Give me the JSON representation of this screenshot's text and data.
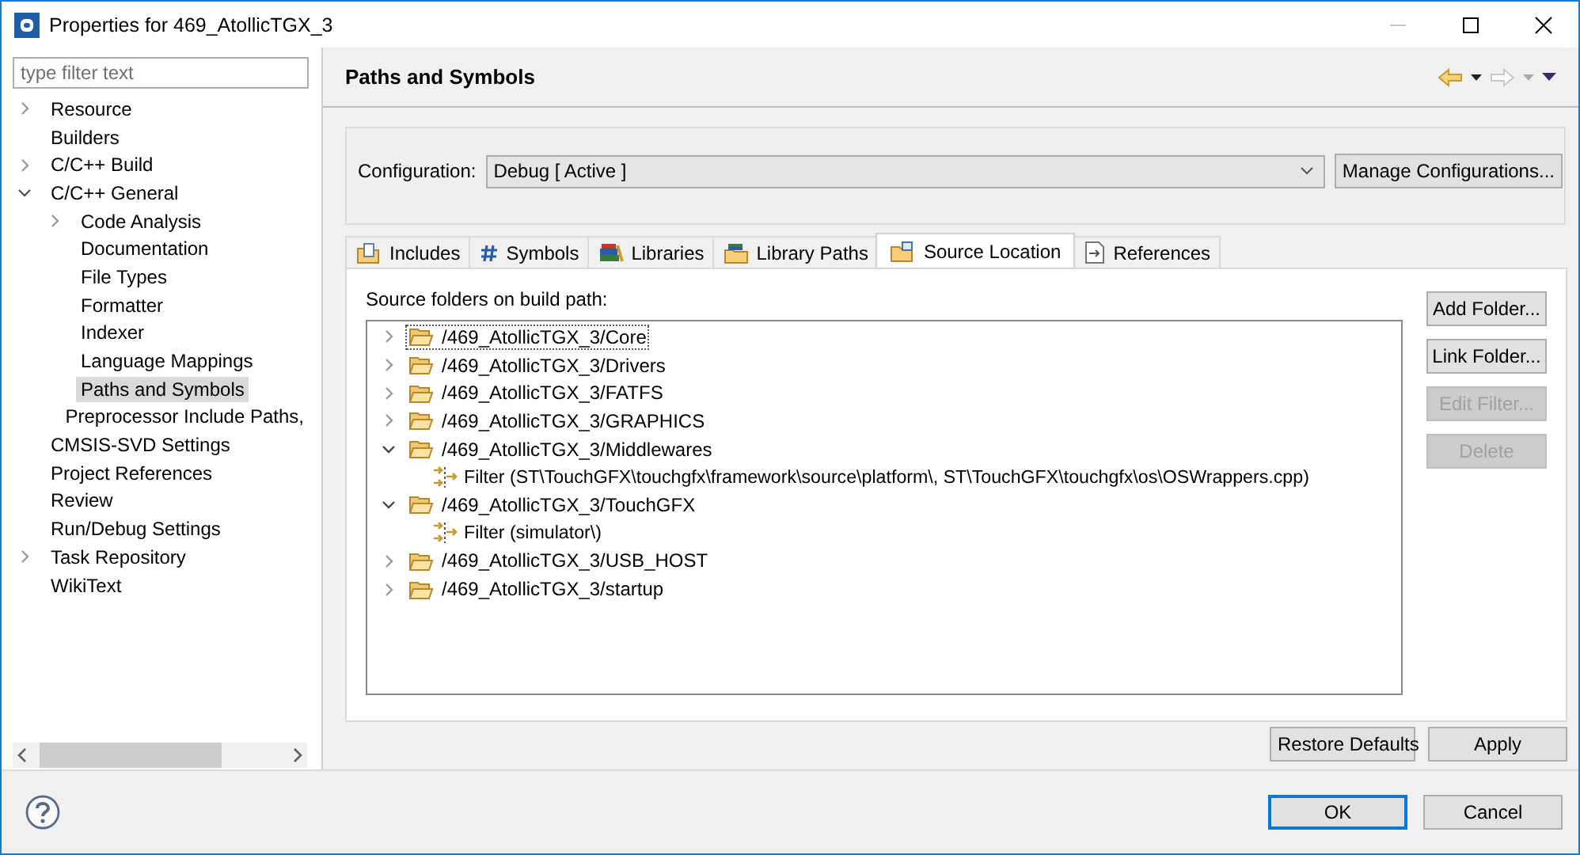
{
  "window": {
    "title": "Properties for 469_AtollicTGX_3"
  },
  "sidebar": {
    "filter": {
      "placeholder": "type filter text"
    },
    "items": [
      {
        "label": "Resource",
        "expanded": false,
        "selected": false
      },
      {
        "label": "Builders",
        "selected": false
      },
      {
        "label": "C/C++ Build",
        "expanded": false,
        "selected": false
      },
      {
        "label": "C/C++ General",
        "expanded": true,
        "selected": false,
        "children": [
          {
            "label": "Code Analysis",
            "expanded": false,
            "selected": false
          },
          {
            "label": "Documentation",
            "selected": false
          },
          {
            "label": "File Types",
            "selected": false
          },
          {
            "label": "Formatter",
            "selected": false
          },
          {
            "label": "Indexer",
            "selected": false
          },
          {
            "label": "Language Mappings",
            "selected": false
          },
          {
            "label": "Paths and Symbols",
            "selected": true
          },
          {
            "label": "Preprocessor Include Paths,",
            "selected": false
          }
        ]
      },
      {
        "label": "CMSIS-SVD Settings",
        "selected": false
      },
      {
        "label": "Project References",
        "selected": false
      },
      {
        "label": "Review",
        "selected": false
      },
      {
        "label": "Run/Debug Settings",
        "selected": false
      },
      {
        "label": "Task Repository",
        "expanded": false,
        "selected": false
      },
      {
        "label": "WikiText",
        "selected": false
      }
    ]
  },
  "page": {
    "title": "Paths and Symbols"
  },
  "configuration": {
    "label": "Configuration:",
    "value": "Debug  [ Active ]",
    "manage_button": "Manage Configurations..."
  },
  "tabs": [
    {
      "label": "Includes",
      "selected": false
    },
    {
      "label": "Symbols",
      "selected": false
    },
    {
      "label": "Libraries",
      "selected": false
    },
    {
      "label": "Library Paths",
      "selected": false
    },
    {
      "label": "Source Location",
      "selected": true
    },
    {
      "label": "References",
      "selected": false
    }
  ],
  "source_location": {
    "heading": "Source folders on build path:",
    "folders": [
      {
        "path": "/469_AtollicTGX_3/Core",
        "expanded": false,
        "focused": true
      },
      {
        "path": "/469_AtollicTGX_3/Drivers",
        "expanded": false,
        "focused": false
      },
      {
        "path": "/469_AtollicTGX_3/FATFS",
        "expanded": false,
        "focused": false
      },
      {
        "path": "/469_AtollicTGX_3/GRAPHICS",
        "expanded": false,
        "focused": false
      },
      {
        "path": "/469_AtollicTGX_3/Middlewares",
        "expanded": true,
        "focused": false,
        "filters": [
          "Filter (ST\\TouchGFX\\touchgfx\\framework\\source\\platform\\, ST\\TouchGFX\\touchgfx\\os\\OSWrappers.cpp)"
        ]
      },
      {
        "path": "/469_AtollicTGX_3/TouchGFX",
        "expanded": true,
        "focused": false,
        "filters": [
          "Filter (simulator\\)"
        ]
      },
      {
        "path": "/469_AtollicTGX_3/USB_HOST",
        "expanded": false,
        "focused": false
      },
      {
        "path": "/469_AtollicTGX_3/startup",
        "expanded": false,
        "focused": false
      }
    ],
    "buttons": [
      {
        "label": "Add Folder...",
        "disabled": false
      },
      {
        "label": "Link Folder...",
        "disabled": false
      },
      {
        "label": "Edit Filter...",
        "disabled": true
      },
      {
        "label": "Delete",
        "disabled": true
      }
    ]
  },
  "restore_defaults_button": "Restore Defaults",
  "apply_button": "Apply",
  "dialog_buttons": [
    {
      "label": "OK",
      "default": true
    },
    {
      "label": "Cancel",
      "default": false
    }
  ]
}
